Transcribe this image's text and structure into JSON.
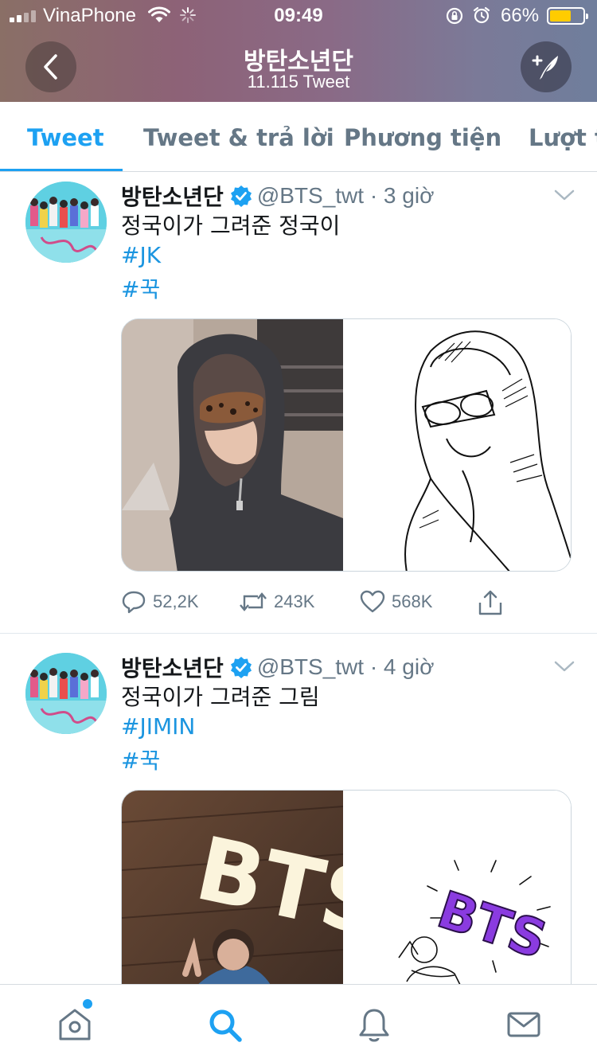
{
  "status_bar": {
    "carrier": "VinaPhone",
    "time": "09:49",
    "battery_percent": "66%",
    "battery_level": 0.66,
    "signal_bars": 4,
    "signal_bars_filled": 2
  },
  "header": {
    "title": "방탄소년단",
    "subtitle": "11.115 Tweet",
    "back_icon": "chevron-left-icon",
    "compose_icon": "compose-tweet-icon",
    "background_colors": [
      "#8a6f66",
      "#8d6277",
      "#7b7a98",
      "#6f7e9c"
    ]
  },
  "tabs": [
    {
      "label": "Tweet",
      "active": true
    },
    {
      "label": "Tweet & trả lời",
      "active": false
    },
    {
      "label": "Phương tiện",
      "active": false
    },
    {
      "label": "Lượt t",
      "active": false
    }
  ],
  "tweets": [
    {
      "author": "방탄소년단",
      "handle_time": "@BTS_twt · 3 giờ",
      "text": "정국이가 그려준 정국이",
      "hashtags": [
        "#JK",
        "#꾹"
      ],
      "media": [
        "photo-hooded-person-sunglasses",
        "sketch-hooded-person-sunglasses"
      ],
      "replies": "52,2K",
      "retweets": "243K",
      "likes": "568K"
    },
    {
      "author": "방탄소년단",
      "handle_time": "@BTS_twt · 4 giờ",
      "text": "정국이가 그려준 그림",
      "hashtags": [
        "#JIMIN",
        "#꾹"
      ],
      "media": [
        "photo-bts-neon-sign",
        "sketch-bts-purple-logo"
      ],
      "media_overlay_text": [
        "BTS",
        "BTS"
      ]
    }
  ],
  "bottom_nav": [
    {
      "name": "home-icon",
      "has_badge": true
    },
    {
      "name": "search-icon",
      "active": true
    },
    {
      "name": "notifications-icon"
    },
    {
      "name": "messages-icon"
    }
  ],
  "colors": {
    "accent": "#1da1f2",
    "hashtag": "#1b95e0",
    "muted": "#657786",
    "battery": "#ffcc00"
  }
}
